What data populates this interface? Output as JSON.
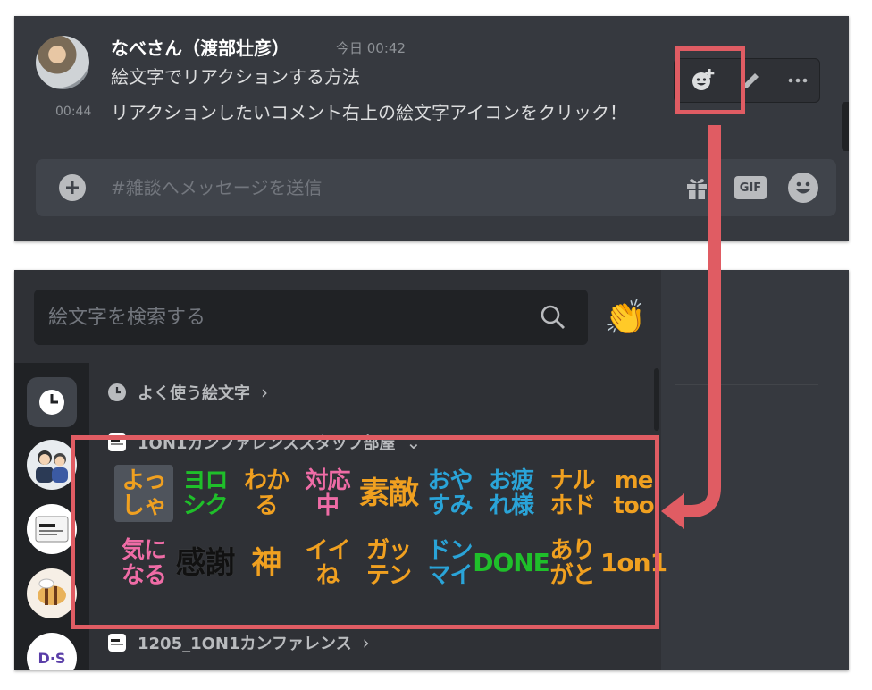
{
  "message": {
    "username": "なべさん（渡部壮彦）",
    "timestamp": "今日 00:42",
    "line1": "絵文字でリアクションする方法",
    "line2_time": "00:44",
    "line2": "リアクションしたいコメント右上の絵文字アイコンをクリック！"
  },
  "toolbar": {
    "icons": [
      "add-reaction-icon",
      "pencil-icon",
      "more-icon"
    ]
  },
  "composer": {
    "placeholder": "#雑談へメッセージを送信",
    "gif_label": "GIF"
  },
  "picker": {
    "search_placeholder": "絵文字を検索する",
    "clap": "👏",
    "categories": [
      {
        "label": "よく使う絵文字",
        "chevron": "›"
      },
      {
        "label": "1ON1カンファレンススタッフ部屋",
        "chevron": "⌄"
      },
      {
        "label": "1205_1ON1カンファレンス",
        "chevron": "›"
      }
    ],
    "sidebar_labels": {
      "ds": "D·S"
    },
    "emojis_row1": [
      {
        "l1": "よっ",
        "l2": "しゃ",
        "color": "#f0a020"
      },
      {
        "l1": "ヨロ",
        "l2": "シク",
        "color": "#1fbf2a"
      },
      {
        "l1": "わか",
        "l2": "る",
        "color": "#f0a020"
      },
      {
        "l1": "対応",
        "l2": "中",
        "color": "#ef6ca6"
      },
      {
        "l1": "素敵",
        "l2": "",
        "color": "#f0a020"
      },
      {
        "l1": "おや",
        "l2": "すみ",
        "color": "#2aa4d8"
      },
      {
        "l1": "お疲",
        "l2": "れ様",
        "color": "#2aa4d8"
      },
      {
        "l1": "ナル",
        "l2": "ホド",
        "color": "#f0a020"
      },
      {
        "l1": "me",
        "l2": "too",
        "color": "#f0a020"
      }
    ],
    "emojis_row2": [
      {
        "l1": "気に",
        "l2": "なる",
        "color": "#ef6ca6"
      },
      {
        "l1": "感謝",
        "l2": "",
        "color": "#111111"
      },
      {
        "l1": "神",
        "l2": "",
        "color": "#f0a020"
      },
      {
        "l1": "イイ",
        "l2": "ね",
        "color": "#f0a020"
      },
      {
        "l1": "ガッ",
        "l2": "テン",
        "color": "#f0a020"
      },
      {
        "l1": "ドン",
        "l2": "マイ",
        "color": "#2aa4d8"
      },
      {
        "l1": "DONE",
        "l2": "",
        "color": "#1fbf2a"
      },
      {
        "l1": "あり",
        "l2": "がと",
        "color": "#f0a020"
      },
      {
        "l1": "1on1",
        "l2": "",
        "color": "#f0a020"
      }
    ]
  },
  "annotation": {
    "color": "#e05c63"
  }
}
